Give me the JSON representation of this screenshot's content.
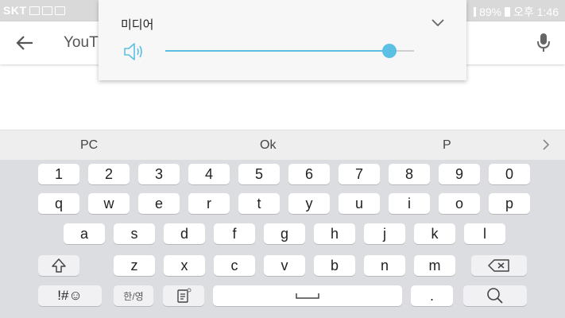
{
  "status_bar": {
    "carrier": "SKT",
    "battery": "89%",
    "time": "오후 1:46"
  },
  "search": {
    "text": "YouT"
  },
  "volume_panel": {
    "title": "미디어",
    "level_fraction": 0.9,
    "accent_color": "#5bc0e3"
  },
  "keyboard": {
    "suggestions": [
      "PC",
      "Ok",
      "P"
    ],
    "rows": [
      [
        "1",
        "2",
        "3",
        "4",
        "5",
        "6",
        "7",
        "8",
        "9",
        "0"
      ],
      [
        "q",
        "w",
        "e",
        "r",
        "t",
        "y",
        "u",
        "i",
        "o",
        "p"
      ],
      [
        "a",
        "s",
        "d",
        "f",
        "g",
        "h",
        "j",
        "k",
        "l"
      ],
      [
        "z",
        "x",
        "c",
        "v",
        "b",
        "n",
        "m"
      ]
    ],
    "sym_label": "!#☺",
    "lang_label": "한/영",
    "period_label": "."
  }
}
